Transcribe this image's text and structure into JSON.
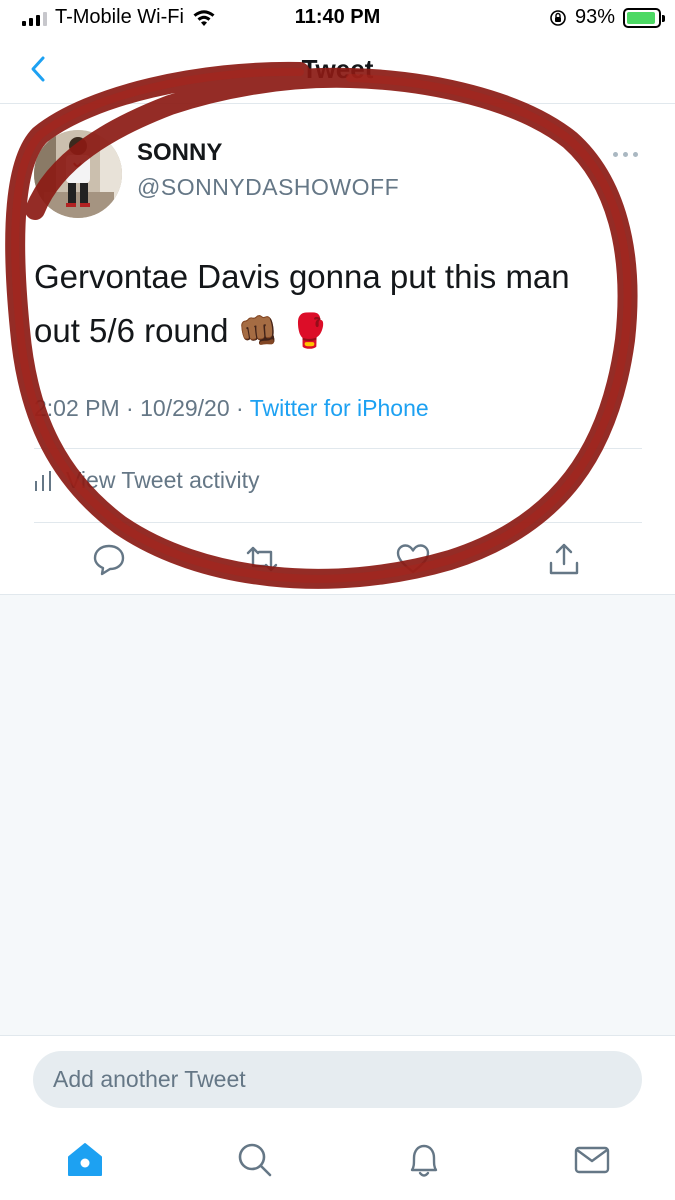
{
  "status_bar": {
    "carrier": "T-Mobile Wi-Fi",
    "time": "11:40 PM",
    "battery": "93%",
    "battery_level": 0.93
  },
  "nav": {
    "title": "Tweet",
    "back_icon": "chevron-left-icon"
  },
  "tweet": {
    "author_name": "SONNY",
    "author_handle": "@SONNYDASHOWOFF",
    "text_line1": "Gervontae Davis gonna put this man",
    "text_line2": "out 5/6 round",
    "emoji": "👊🏾 🥊",
    "time": "2:02 PM",
    "separator": "·",
    "date": "10/29/20",
    "source": "Twitter for iPhone",
    "activity_label": "View Tweet activity"
  },
  "actions": {
    "reply_icon": "reply-icon",
    "retweet_icon": "retweet-icon",
    "like_icon": "heart-icon",
    "share_icon": "share-icon"
  },
  "composer": {
    "placeholder": "Add another Tweet"
  },
  "tab_bar": {
    "items": [
      "home-icon",
      "search-icon",
      "notifications-icon",
      "messages-icon"
    ]
  },
  "colors": {
    "accent": "#1da1f2",
    "secondary_text": "#657786",
    "annotation": "#8b1a14"
  }
}
